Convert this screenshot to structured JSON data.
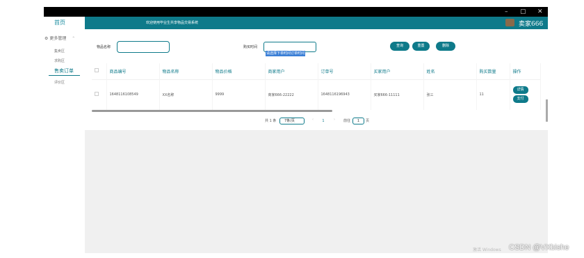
{
  "window": {
    "minimize_glyph": "–",
    "maximize_glyph": "▢",
    "close_glyph": "✕"
  },
  "header": {
    "welcome": "欢迎使用毕业生共享物品交易系统",
    "username": "卖家666",
    "avatar_icon": "user-avatar-icon"
  },
  "sidebar": {
    "home": "首页",
    "group_label": "更多管理",
    "group_icon": "settings-icon",
    "chevron_icon": "chevron-up-icon",
    "items": [
      {
        "label": "集卖区"
      },
      {
        "label": "求购区"
      },
      {
        "label": "售卖订单"
      },
      {
        "label": "评价区"
      }
    ]
  },
  "search": {
    "name_label": "物品名称",
    "name_value": "",
    "time_label": "购买时间",
    "time_value": "请选择下单时间订单时间"
  },
  "actions": {
    "query": "查询",
    "reset": "重置",
    "delete": "删除"
  },
  "table": {
    "headers": [
      "",
      "商品编号",
      "物品名称",
      "物品价格",
      "商家用户",
      "订单号",
      "买家用户",
      "姓名",
      "购买数量",
      "操作"
    ],
    "rows": [
      {
        "cells": [
          "",
          "1648116108549",
          "XX名称",
          "9999",
          "商家666-22222",
          "1648116196943",
          "买家666-11111",
          "张三",
          "11"
        ],
        "actions": [
          "详情",
          "支付"
        ]
      }
    ]
  },
  "pagination": {
    "total": "共 1 条",
    "page_size": "7条/页",
    "prev": "‹",
    "current": "1",
    "next": "›",
    "goto_prefix": "前往",
    "goto_value": "1",
    "goto_suffix": "页"
  },
  "overlay": {
    "windows_watermark": "激活 Windows",
    "csdn": "CSDN @VXbishe"
  },
  "colors": {
    "accent": "#0e7a8a",
    "titlebar": "#000000",
    "main_bg": "#f0f0f0"
  }
}
